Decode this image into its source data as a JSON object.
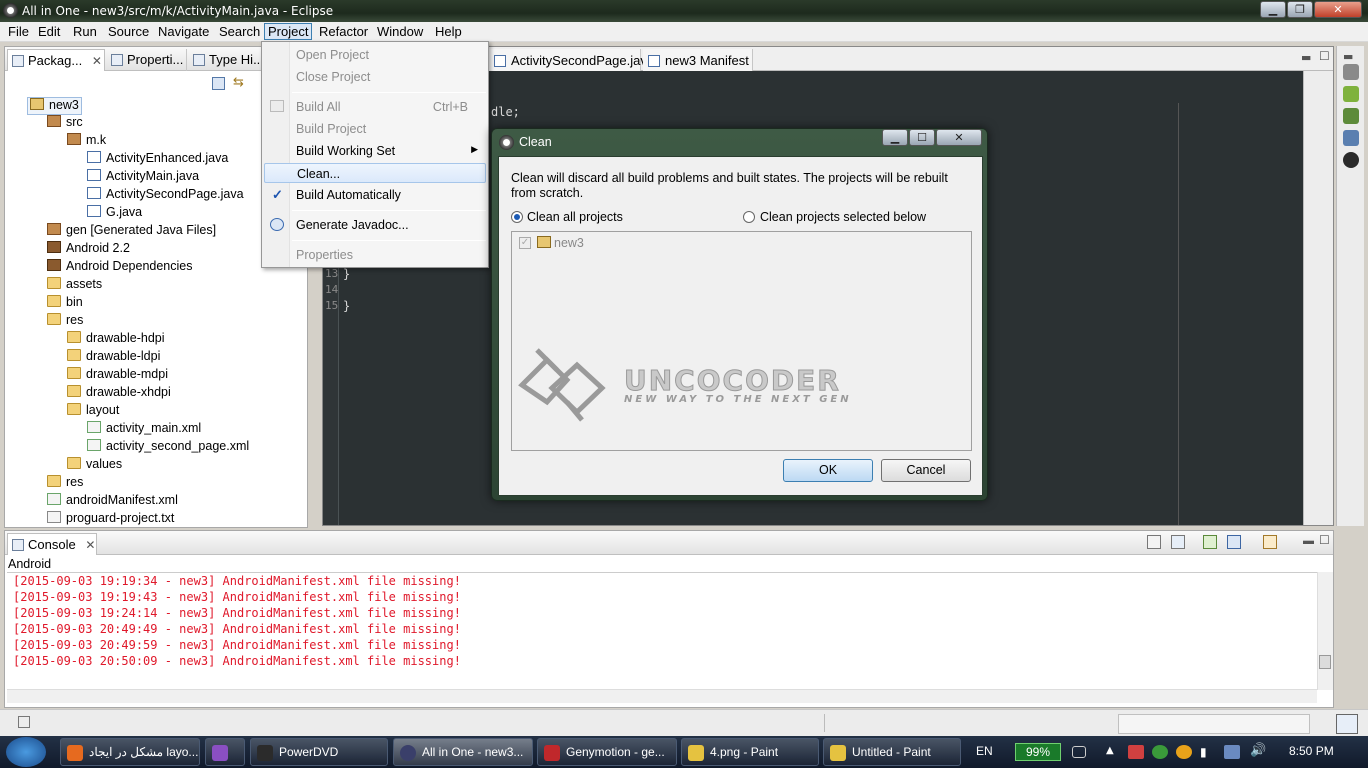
{
  "window": {
    "title": "All in One - new3/src/m/k/ActivityMain.java - Eclipse"
  },
  "menubar": [
    "File",
    "Edit",
    "Run",
    "Source",
    "Navigate",
    "Search",
    "Project",
    "Refactor",
    "Window",
    "Help"
  ],
  "left_tabs": [
    "Packag...",
    "Properti...",
    "Type Hi..."
  ],
  "tree": [
    {
      "label": "new3",
      "icon": "proj",
      "level": 0
    },
    {
      "label": "src",
      "icon": "pkg",
      "level": 1
    },
    {
      "label": "m.k",
      "icon": "pkg",
      "level": 2
    },
    {
      "label": "ActivityEnhanced.java",
      "icon": "java",
      "level": 3
    },
    {
      "label": "ActivityMain.java",
      "icon": "java",
      "level": 3
    },
    {
      "label": "ActivitySecondPage.java",
      "icon": "java",
      "level": 3
    },
    {
      "label": "G.java",
      "icon": "java",
      "level": 3
    },
    {
      "label": "gen [Generated Java Files]",
      "icon": "pkg",
      "level": 1
    },
    {
      "label": "Android 2.2",
      "icon": "lib",
      "level": 1
    },
    {
      "label": "Android Dependencies",
      "icon": "lib",
      "level": 1
    },
    {
      "label": "assets",
      "icon": "folder",
      "level": 1
    },
    {
      "label": "bin",
      "icon": "folder",
      "level": 1
    },
    {
      "label": "res",
      "icon": "folder",
      "level": 1
    },
    {
      "label": "drawable-hdpi",
      "icon": "folder",
      "level": 2
    },
    {
      "label": "drawable-ldpi",
      "icon": "folder",
      "level": 2
    },
    {
      "label": "drawable-mdpi",
      "icon": "folder",
      "level": 2
    },
    {
      "label": "drawable-xhdpi",
      "icon": "folder",
      "level": 2
    },
    {
      "label": "layout",
      "icon": "folder",
      "level": 2
    },
    {
      "label": "activity_main.xml",
      "icon": "xml",
      "level": 3
    },
    {
      "label": "activity_second_page.xml",
      "icon": "xml",
      "level": 3
    },
    {
      "label": "values",
      "icon": "folder",
      "level": 2
    },
    {
      "label": "res",
      "icon": "folder",
      "level": 1
    },
    {
      "label": "androidManifest.xml",
      "icon": "xml",
      "level": 1
    },
    {
      "label": "proguard-project.txt",
      "icon": "file",
      "level": 1
    }
  ],
  "editor": {
    "tabs": [
      "ActivitySecondPage.java",
      "new3 Manifest"
    ],
    "code_lines": [
      {
        "num": "",
        "text": "dle;"
      },
      {
        "num": "13",
        "text": "    }"
      },
      {
        "num": "14",
        "text": ""
      },
      {
        "num": "15",
        "text": "}"
      }
    ]
  },
  "project_menu": {
    "items": [
      {
        "label": "Open Project",
        "disabled": true
      },
      {
        "label": "Close Project",
        "disabled": true
      },
      {
        "label": "Build All",
        "disabled": true,
        "accel": "Ctrl+B"
      },
      {
        "label": "Build Project",
        "disabled": true
      },
      {
        "label": "Build Working Set",
        "disabled": false
      },
      {
        "label": "Clean...",
        "disabled": false
      },
      {
        "label": "Build Automatically",
        "disabled": false,
        "checked": true
      },
      {
        "label": "Generate Javadoc...",
        "disabled": false
      },
      {
        "label": "Properties",
        "disabled": true
      }
    ]
  },
  "clean_dialog": {
    "title": "Clean",
    "description": "Clean will discard all build problems and built states.  The projects will be rebuilt from scratch.",
    "option_all": "Clean all projects",
    "option_selected": "Clean projects selected below",
    "selected_option": "all",
    "projects": [
      "new3"
    ],
    "ok": "OK",
    "cancel": "Cancel",
    "watermark_main": "UNCOCODER",
    "watermark_sub": "NEW WAY TO THE NEXT GEN"
  },
  "console": {
    "tab": "Console",
    "name": "Android",
    "lines": [
      "[2015-09-03 19:19:34 - new3] AndroidManifest.xml file missing!",
      "[2015-09-03 19:19:43 - new3] AndroidManifest.xml file missing!",
      "[2015-09-03 19:24:14 - new3] AndroidManifest.xml file missing!",
      "[2015-09-03 20:49:49 - new3] AndroidManifest.xml file missing!",
      "[2015-09-03 20:49:59 - new3] AndroidManifest.xml file missing!",
      "[2015-09-03 20:50:09 - new3] AndroidManifest.xml file missing!"
    ],
    "error_color": "#e0192b"
  },
  "taskbar": {
    "tasks": [
      {
        "label": "مشکل در ایجاد layo...",
        "icon": "firefox-icon"
      },
      {
        "label": "",
        "icon": "visual-studio-icon"
      },
      {
        "label": "PowerDVD",
        "icon": "powerdvd-icon"
      },
      {
        "label": "All in One - new3...",
        "icon": "eclipse-icon",
        "active": true
      },
      {
        "label": "Genymotion - ge...",
        "icon": "genymotion-icon"
      },
      {
        "label": "4.png - Paint",
        "icon": "paint-icon"
      },
      {
        "label": "Untitled - Paint",
        "icon": "paint-icon"
      }
    ],
    "lang": "EN",
    "battery": "99%",
    "clock": "8:50 PM"
  }
}
